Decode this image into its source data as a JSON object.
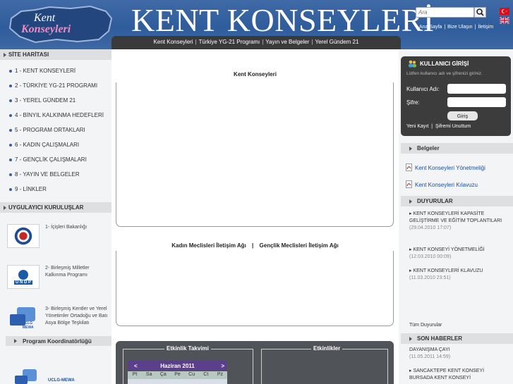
{
  "header": {
    "logo_text": "Kent Konseyleri",
    "site_title": "KENT KONSEYLERİ",
    "search_placeholder": "Ara",
    "top_links": [
      "Ana Sayfa",
      "Bize Ulaşın",
      "İletişim"
    ],
    "nav": [
      "Kent Konseyleri",
      "Türkiye YG-21 Programı",
      "Yayın ve Belgeler",
      "Yerel Gündem 21"
    ]
  },
  "left": {
    "sitemap_title": "SİTE HARİTASI",
    "sitemap_items": [
      "1 - KENT KONSEYLERİ",
      "2 - TÜRKİYE YG-21 PROGRAMI",
      "3 - YEREL GÜNDEM 21",
      "4 - BİNYIL KALKINMA HEDEFLERİ",
      "5 - PROGRAM ORTAKLARI",
      "6 - KADIN ÇALIŞMALARI",
      "7 - GENÇLİK ÇALIŞMALARI",
      "8 - YAYIN VE BELGELER",
      "9 - LİNKLER"
    ],
    "implementers_title": "UYGULAYICI KURULUŞLAR",
    "orgs": [
      "1- İçişleri Bakanlığı",
      "2- Birleşmiş Milletler Kalkınma Programı",
      "3- Birleşmiş Kentler ve Yerel Yönetimler Ortadoğu ve Batı Asya Bölge Teşkilatı"
    ],
    "coordinators_title": "Program Koordinatörlüğü",
    "coordinator_logo_text": "UCLG-MEWA",
    "undp_logo_text": "U N D P",
    "uclg_logo_text": "UCLG MEWA"
  },
  "center": {
    "box1_title": "Kent Konseyleri",
    "box2_title_a": "Kadın Meclisleri İletişim Ağı",
    "box2_sep": "|",
    "box2_title_b": "Gençlik Meclisleri İletişim Ağı",
    "events_calendar_title": "Etkinlik Takvimi",
    "events_title": "Etkinlikler",
    "calendar": {
      "prev": "<",
      "month": "Haziran 2011",
      "next": ">",
      "days": [
        "Pt",
        "Sa",
        "Ça",
        "Pe",
        "Cu",
        "Ct",
        "Pz"
      ]
    }
  },
  "right": {
    "login": {
      "title": "KULLANICI GİRİŞİ",
      "hint": "Lütfen kullanıcı adı ve şifrenizi giriniz.",
      "username_label": "Kullanıcı Adı:",
      "password_label": "Şifre:",
      "submit": "Giriş",
      "register": "Yeni Kayıt",
      "forgot": "Şifremi Unuttum",
      "sep": "|"
    },
    "documents_title": "Belgeler",
    "documents": [
      "Kent Konseyleri Yönetmeliği",
      "Kent Konseyleri Kılavuzu"
    ],
    "announcements_title": "DUYURULAR",
    "announcements": [
      {
        "text": "KENT KONSEYLERİ KAPASİTE GELİŞTİRME VE EĞİTİM TOPLANTILARI",
        "date": "(29.04.2010 17:07)"
      },
      {
        "text": "KENT KONSEYİ YÖNETMELİĞİ",
        "date": "(12.03.2010 00:09)"
      },
      {
        "text": "KENT KONSEYLERİ KLAVUZU",
        "date": "(11.03.2010 23:51)"
      }
    ],
    "all_announcements": "Tüm Duyurular",
    "news_title": "SON HABERLER",
    "news": [
      {
        "text": "DAYANIŞMA ÇAYI",
        "date": "(11.05.2011 14:59)"
      },
      {
        "text": "SANCAKTEPE KENT KONSEYİ BURSADA KENT KONSEYİ"
      }
    ]
  },
  "colors": {
    "header_blue": "#2f5c9c",
    "dark_panel": "#3c3c3c",
    "calendar_purple": "#5b3f8c",
    "link_blue": "#1a4fa0"
  }
}
